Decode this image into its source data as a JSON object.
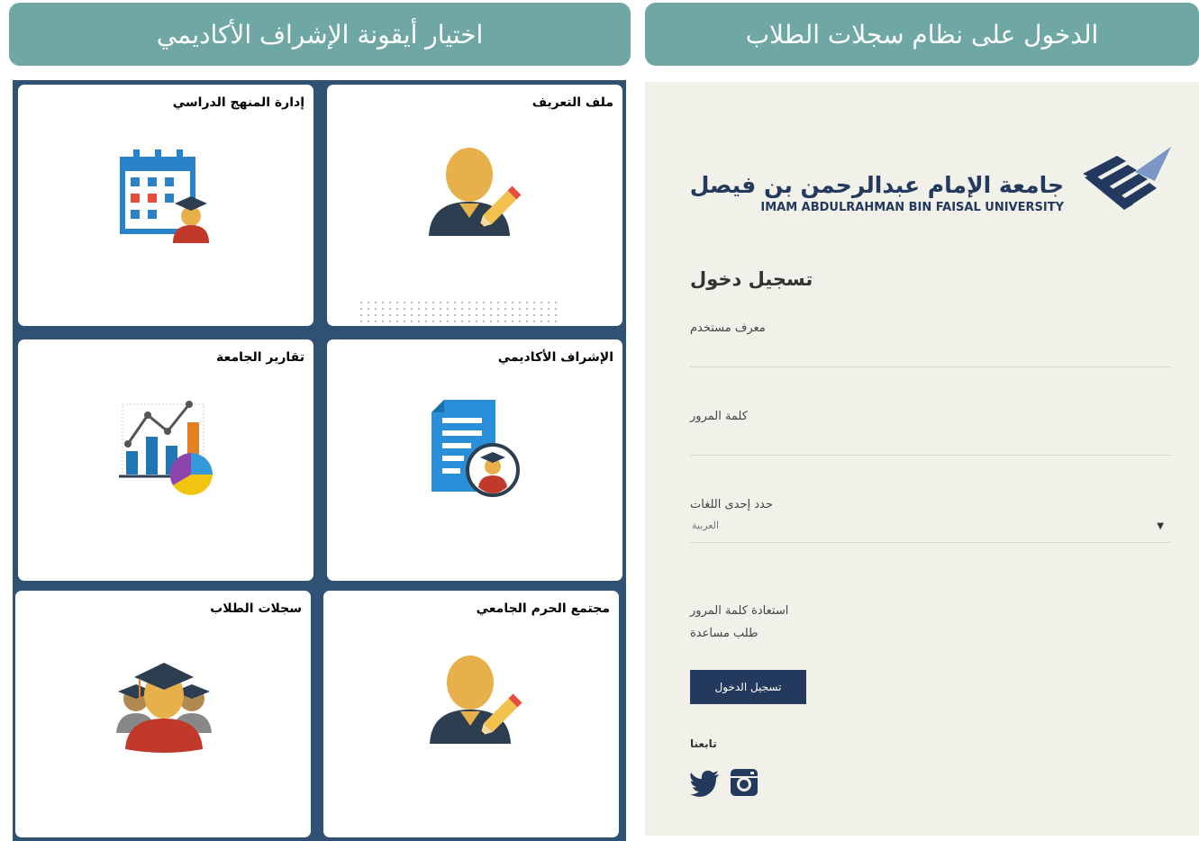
{
  "banners": {
    "left": "اختيار أيقونة الإشراف الأكاديمي",
    "right": "الدخول على نظام سجلات الطلاب"
  },
  "tiles": [
    {
      "label": "ملف التعريف",
      "icon": "profile-edit-icon"
    },
    {
      "label": "إدارة المنهج الدراسي",
      "icon": "calendar-graduate-icon"
    },
    {
      "label": "الإشراف الأكاديمي",
      "icon": "document-advisor-icon"
    },
    {
      "label": "تقارير الجامعة",
      "icon": "reports-chart-icon"
    },
    {
      "label": "مجتمع الحرم الجامعي",
      "icon": "profile-edit-icon"
    },
    {
      "label": "سجلات الطلاب",
      "icon": "students-graduates-icon"
    }
  ],
  "login": {
    "university_ar": "جامعة الإمام عبدالرحمن بن فيصل",
    "university_en": "IMAM ABDULRAHMAN BIN FAISAL UNIVERSITY",
    "title": "تسجيل دخول",
    "username_label": "معرف مستخدم",
    "password_label": "كلمة المرور",
    "language_label": "حدد إحدى اللغات",
    "language_value": "العربية",
    "forgot_password": "استعادة كلمة المرور",
    "help_request": "طلب مساعدة",
    "signin_button": "تسجيل الدخول",
    "follow_us": "تابعنا",
    "social": [
      "twitter-icon",
      "instagram-icon"
    ]
  },
  "colors": {
    "banner": "#6ea7a3",
    "tiles_background": "#2f5272",
    "login_background": "#f1f0e9",
    "button": "#23395d"
  }
}
